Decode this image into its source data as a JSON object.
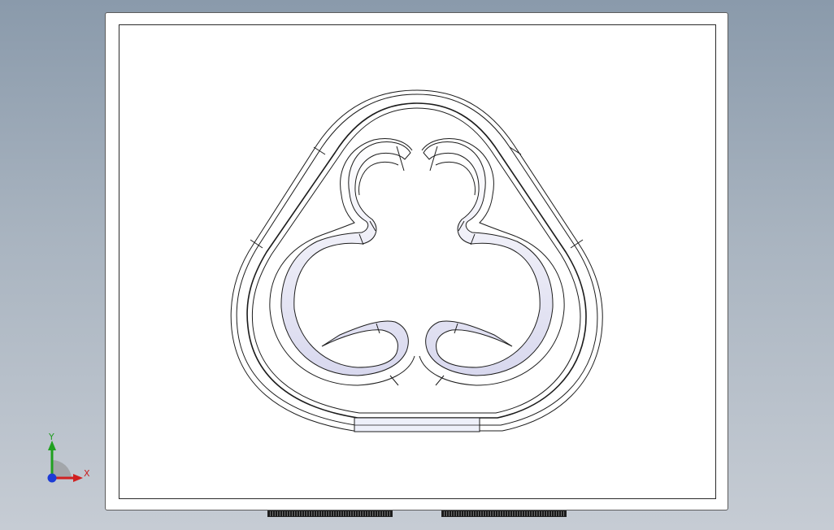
{
  "viewport": {
    "background": "#a9b4c0",
    "sheet_color": "#ffffff",
    "part_fill": "#e9e9f6",
    "line_color": "#1c1c1c"
  },
  "triad": {
    "x_label": "X",
    "y_label": "Y",
    "x_color": "#d02020",
    "y_color": "#20a020",
    "z_color": "#1c3bd6"
  },
  "sheet_tabs": {
    "count": 2
  }
}
